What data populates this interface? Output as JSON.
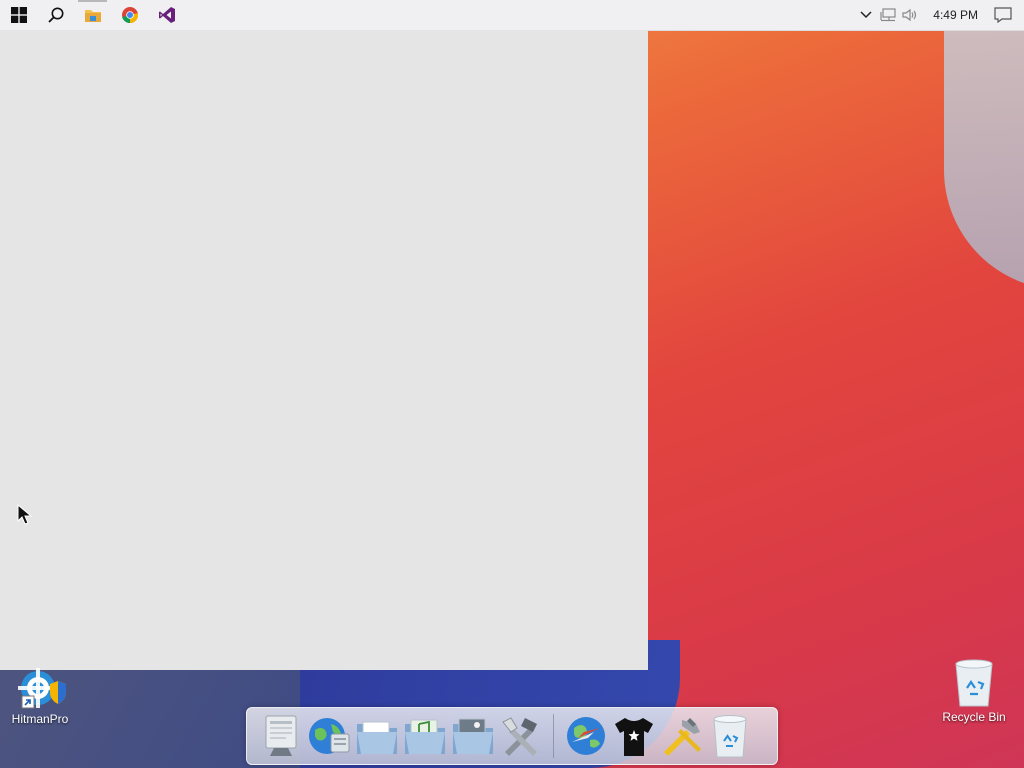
{
  "taskbar": {
    "apps": [
      {
        "name": "start",
        "icon": "windows-logo-icon"
      },
      {
        "name": "search",
        "icon": "search-icon"
      },
      {
        "name": "file-explorer",
        "icon": "folder-icon"
      },
      {
        "name": "chrome",
        "icon": "chrome-icon"
      },
      {
        "name": "visual-studio",
        "icon": "visual-studio-icon"
      }
    ],
    "clock": "4:49 PM"
  },
  "desktop": {
    "icons": [
      {
        "label": "HitmanPro",
        "icon": "hitmanpro-icon"
      },
      {
        "label": "Recycle Bin",
        "icon": "recycle-bin-icon"
      }
    ]
  },
  "dock": {
    "items": [
      "finder-monitor-icon",
      "network-globe-icon",
      "documents-folder-icon",
      "music-folder-icon",
      "pictures-folder-icon",
      "system-tools-icon",
      "web-browser-icon",
      "tshirt-app-icon",
      "developer-hammer-icon",
      "trash-icon"
    ]
  },
  "colors": {
    "taskbar_bg": "#f0f0f2",
    "window_bg": "#e5e5e5",
    "accent_purple": "#68217a",
    "chrome_red": "#db4437",
    "chrome_green": "#0f9d58",
    "chrome_yellow": "#f4b400",
    "chrome_blue": "#4285f4"
  }
}
